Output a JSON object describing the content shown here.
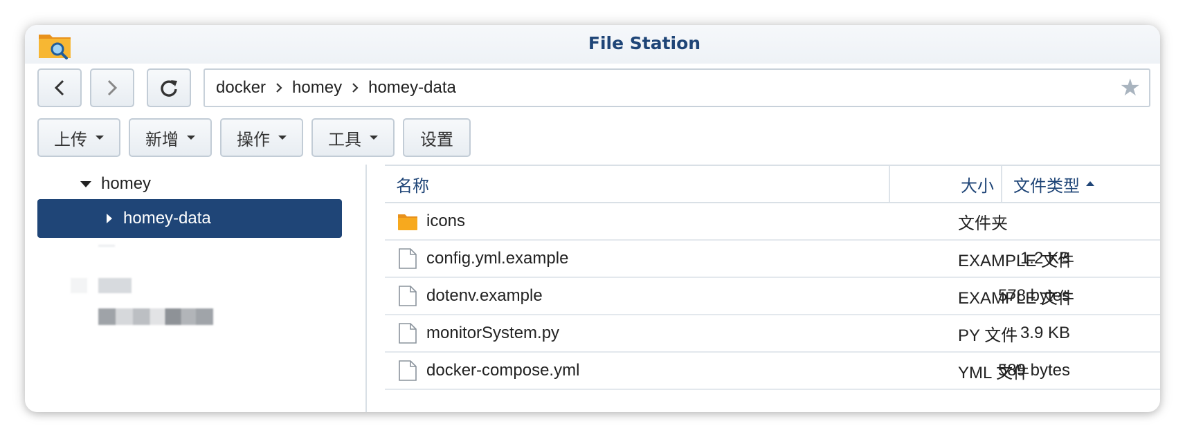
{
  "window": {
    "title": "File Station"
  },
  "nav": {
    "back_icon": "chevron-left-icon",
    "forward_icon": "chevron-right-icon",
    "refresh_icon": "refresh-icon",
    "breadcrumb": [
      "docker",
      "homey",
      "homey-data"
    ],
    "favorite_icon": "star-icon"
  },
  "toolbar": {
    "upload": "上传",
    "create": "新增",
    "action": "操作",
    "tools": "工具",
    "settings": "设置"
  },
  "tree": {
    "parent": "homey",
    "selected": "homey-data"
  },
  "table": {
    "headers": {
      "name": "名称",
      "size": "大小",
      "type": "文件类型"
    },
    "rows": [
      {
        "icon": "folder-icon",
        "name": "icons",
        "size": "",
        "type": "文件夹"
      },
      {
        "icon": "file-icon",
        "name": "config.yml.example",
        "size": "1.2 KB",
        "type": "EXAMPLE 文件"
      },
      {
        "icon": "file-icon",
        "name": "dotenv.example",
        "size": "578 bytes",
        "type": "EXAMPLE 文件"
      },
      {
        "icon": "file-icon",
        "name": "monitorSystem.py",
        "size": "3.9 KB",
        "type": "PY 文件"
      },
      {
        "icon": "file-icon",
        "name": "docker-compose.yml",
        "size": "589 bytes",
        "type": "YML 文件"
      }
    ]
  },
  "colors": {
    "accent": "#1f4577",
    "folder": "#f5a623",
    "selection": "#1f4577"
  }
}
